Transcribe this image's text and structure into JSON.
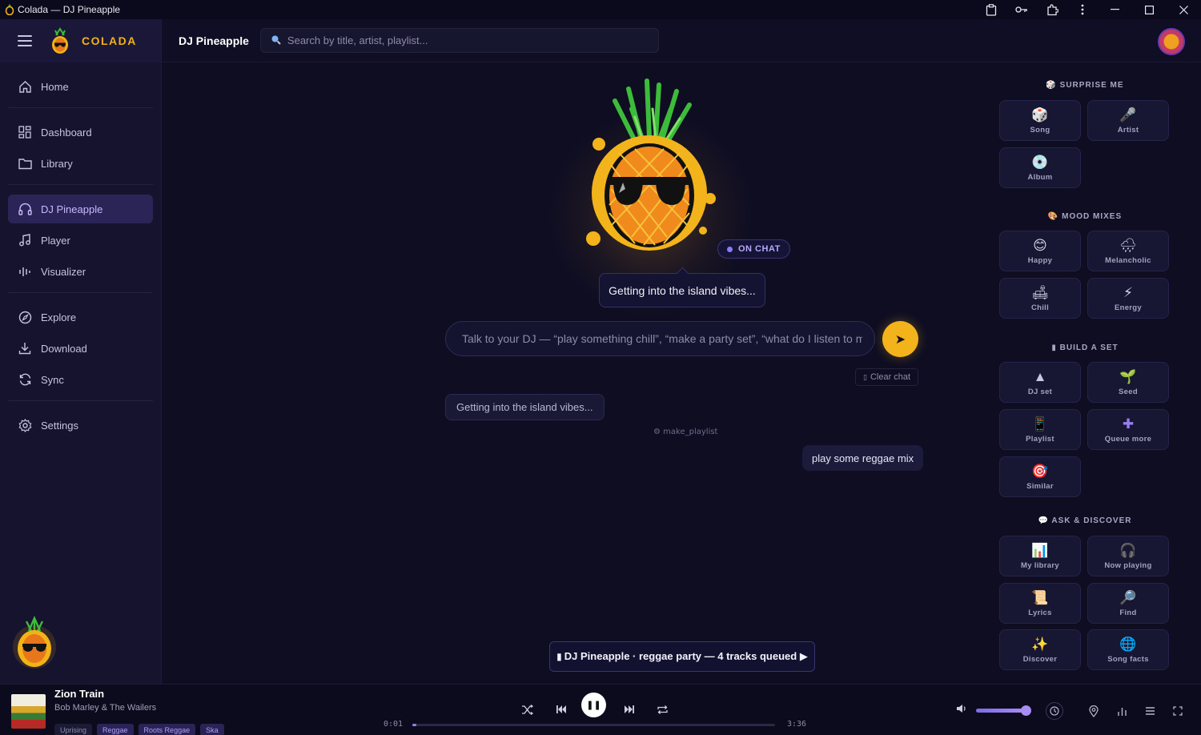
{
  "window": {
    "title": "Colada — DJ Pineapple"
  },
  "brand": {
    "name": "COLADA"
  },
  "sidebar": {
    "items": [
      {
        "label": "Home",
        "icon": "home-icon"
      },
      {
        "label": "Dashboard",
        "icon": "dashboard-icon"
      },
      {
        "label": "Library",
        "icon": "folder-icon"
      },
      {
        "label": "DJ Pineapple",
        "icon": "headphones-icon",
        "active": true
      },
      {
        "label": "Player",
        "icon": "music-note-icon"
      },
      {
        "label": "Visualizer",
        "icon": "bars-icon"
      },
      {
        "label": "Explore",
        "icon": "compass-icon"
      },
      {
        "label": "Download",
        "icon": "download-icon"
      },
      {
        "label": "Sync",
        "icon": "sync-icon"
      },
      {
        "label": "Settings",
        "icon": "gear-icon"
      }
    ]
  },
  "header": {
    "page_title": "DJ Pineapple",
    "search_placeholder": "Search by title, artist, playlist..."
  },
  "dj": {
    "status": "ON CHAT",
    "speech": "Getting into the island vibes...",
    "input_placeholder": "Talk to your DJ — “play something chill”, “make a party set”, “what do I listen to m",
    "clear_chat": "Clear chat",
    "messages": [
      {
        "role": "dj",
        "text": "Getting into the island vibes..."
      },
      {
        "role": "tool",
        "text": "make_playlist"
      },
      {
        "role": "user",
        "text": "play some reggae mix"
      }
    ],
    "queued_banner": "DJ Pineapple · reggae party — 4 tracks queued ▶"
  },
  "panel": {
    "surprise": {
      "title": "SURPRISE ME",
      "tiles": [
        {
          "emoji": "🎲",
          "label": "Song"
        },
        {
          "emoji": "🎤",
          "label": "Artist"
        },
        {
          "emoji": "💿",
          "label": "Album"
        }
      ]
    },
    "mood": {
      "title": "MOOD MIXES",
      "tiles": [
        {
          "emoji": "😊",
          "label": "Happy"
        },
        {
          "emoji": "🌧",
          "label": "Melancholic"
        },
        {
          "emoji": "🛋",
          "label": "Chill"
        },
        {
          "emoji": "⚡",
          "label": "Energy"
        }
      ]
    },
    "build": {
      "title": "BUILD A SET",
      "tiles": [
        {
          "emoji": "▲",
          "label": "DJ set"
        },
        {
          "emoji": "🌱",
          "label": "Seed"
        },
        {
          "emoji": "📱",
          "label": "Playlist"
        },
        {
          "emoji": "✚",
          "label": "Queue more"
        },
        {
          "emoji": "🎯",
          "label": "Similar"
        }
      ]
    },
    "ask": {
      "title": "ASK & DISCOVER",
      "tiles": [
        {
          "emoji": "📊",
          "label": "My library"
        },
        {
          "emoji": "🎧",
          "label": "Now playing"
        },
        {
          "emoji": "📜",
          "label": "Lyrics"
        },
        {
          "emoji": "🔎",
          "label": "Find"
        },
        {
          "emoji": "✨",
          "label": "Discover"
        },
        {
          "emoji": "🌐",
          "label": "Song facts"
        }
      ]
    }
  },
  "player": {
    "title": "Zion Train",
    "artist": "Bob Marley & The Wailers",
    "tags": [
      "Uprising",
      "Reggae",
      "Roots Reggae",
      "Ska"
    ],
    "elapsed": "0:01",
    "duration": "3:36",
    "progress": 0.01,
    "volume": 0.95
  }
}
